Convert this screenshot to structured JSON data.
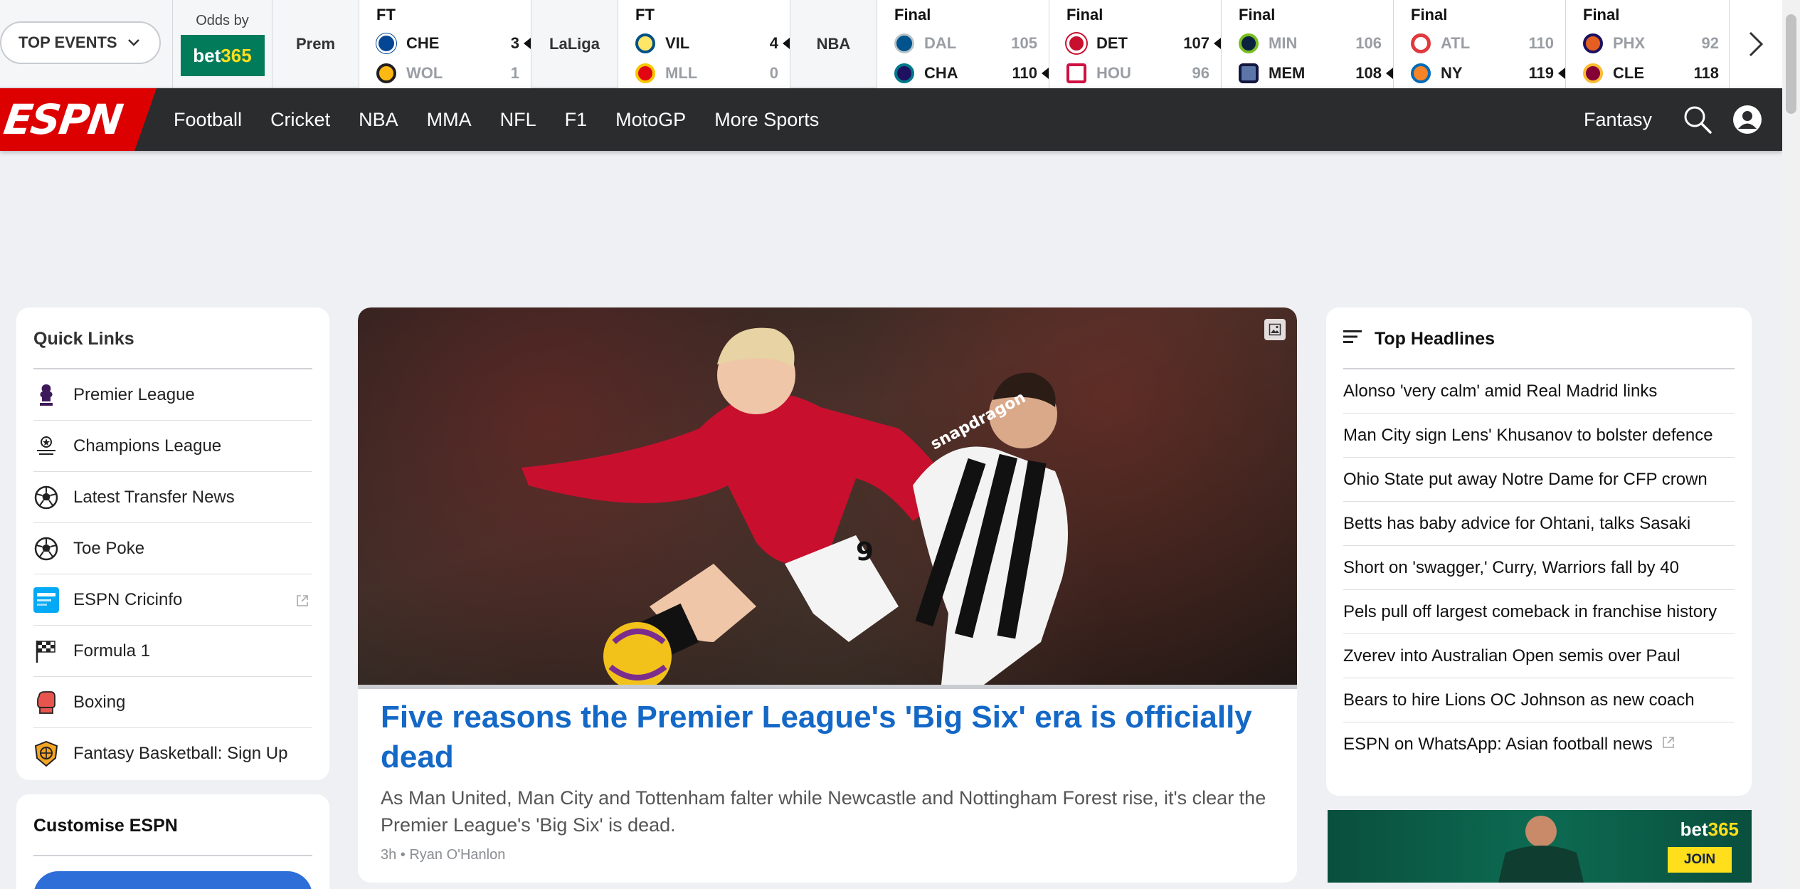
{
  "scorestrip": {
    "top_events_label": "TOP EVENTS",
    "odds_label": "Odds by",
    "odds_brand_main": "bet",
    "odds_brand_accent": "365",
    "leagues": [
      "Prem",
      "LaLiga",
      "NBA"
    ],
    "games": [
      {
        "status": "FT",
        "teams": [
          {
            "abbr": "CHE",
            "score": "3",
            "winner": true,
            "color": "#034694"
          },
          {
            "abbr": "WOL",
            "score": "1",
            "winner": false,
            "color": "#fdb913"
          }
        ]
      },
      {
        "status": "FT",
        "teams": [
          {
            "abbr": "VIL",
            "score": "4",
            "winner": true,
            "color": "#ffe667"
          },
          {
            "abbr": "MLL",
            "score": "0",
            "winner": false,
            "color": "#e20613"
          }
        ]
      },
      {
        "status": "Final",
        "teams": [
          {
            "abbr": "DAL",
            "score": "105",
            "winner": false,
            "color": "#00538c"
          },
          {
            "abbr": "CHA",
            "score": "110",
            "winner": true,
            "color": "#1d1160"
          }
        ]
      },
      {
        "status": "Final",
        "teams": [
          {
            "abbr": "DET",
            "score": "107",
            "winner": true,
            "color": "#c8102e"
          },
          {
            "abbr": "HOU",
            "score": "96",
            "winner": false,
            "color": "#ce1141"
          }
        ]
      },
      {
        "status": "Final",
        "teams": [
          {
            "abbr": "MIN",
            "score": "106",
            "winner": false,
            "color": "#0c2340"
          },
          {
            "abbr": "MEM",
            "score": "108",
            "winner": true,
            "color": "#5d76a9"
          }
        ]
      },
      {
        "status": "Final",
        "teams": [
          {
            "abbr": "ATL",
            "score": "110",
            "winner": false,
            "color": "#e03a3e"
          },
          {
            "abbr": "NY",
            "score": "119",
            "winner": true,
            "color": "#f58426"
          }
        ]
      },
      {
        "status": "Final",
        "teams": [
          {
            "abbr": "PHX",
            "score": "92",
            "winner": false,
            "color": "#e56020"
          },
          {
            "abbr": "CLE",
            "score": "118",
            "winner": true,
            "color": "#860038"
          }
        ]
      }
    ]
  },
  "nav": {
    "brand": "ESPN",
    "links": [
      "Football",
      "Cricket",
      "NBA",
      "MMA",
      "NFL",
      "F1",
      "MotoGP",
      "More Sports"
    ],
    "fantasy": "Fantasy"
  },
  "quick_links": {
    "title": "Quick Links",
    "items": [
      {
        "label": "Premier League",
        "icon": "premier-league-icon"
      },
      {
        "label": "Champions League",
        "icon": "champions-league-icon"
      },
      {
        "label": "Latest Transfer News",
        "icon": "soccer-ball-icon"
      },
      {
        "label": "Toe Poke",
        "icon": "soccer-ball-icon"
      },
      {
        "label": "ESPN Cricinfo",
        "icon": "cricinfo-icon",
        "external": true
      },
      {
        "label": "Formula 1",
        "icon": "checkered-flag-icon"
      },
      {
        "label": "Boxing",
        "icon": "boxing-glove-icon"
      },
      {
        "label": "Fantasy Basketball: Sign Up",
        "icon": "fantasy-basketball-icon"
      }
    ]
  },
  "customise": {
    "title": "Customise ESPN"
  },
  "article": {
    "headline": "Five reasons the Premier League's 'Big Six' era is officially dead",
    "summary": "As Man United, Man City and Tottenham falter while Newcastle and Nottingham Forest rise, it's clear the Premier League's 'Big Six' is dead.",
    "byline": "3h • Ryan O'Hanlon",
    "shirt_text": "snapdragon",
    "shirt_number": "9"
  },
  "top_headlines": {
    "title": "Top Headlines",
    "items": [
      {
        "label": "Alonso 'very calm' amid Real Madrid links"
      },
      {
        "label": "Man City sign Lens' Khusanov to bolster defence"
      },
      {
        "label": "Ohio State put away Notre Dame for CFP crown"
      },
      {
        "label": "Betts has baby advice for Ohtani, talks Sasaki"
      },
      {
        "label": "Short on 'swagger,' Curry, Warriors fall by 40"
      },
      {
        "label": "Pels pull off largest comeback in franchise history"
      },
      {
        "label": "Zverev into Australian Open semis over Paul"
      },
      {
        "label": "Bears to hire Lions OC Johnson as new coach"
      },
      {
        "label": "ESPN on WhatsApp: Asian football news",
        "external": true
      }
    ]
  },
  "ad": {
    "brand_main": "bet",
    "brand_accent": "365",
    "cta": "JOIN"
  },
  "colors": {
    "accent_red": "#dd0000",
    "link_blue": "#1468c6",
    "nav_bg": "#2b2c2d"
  }
}
